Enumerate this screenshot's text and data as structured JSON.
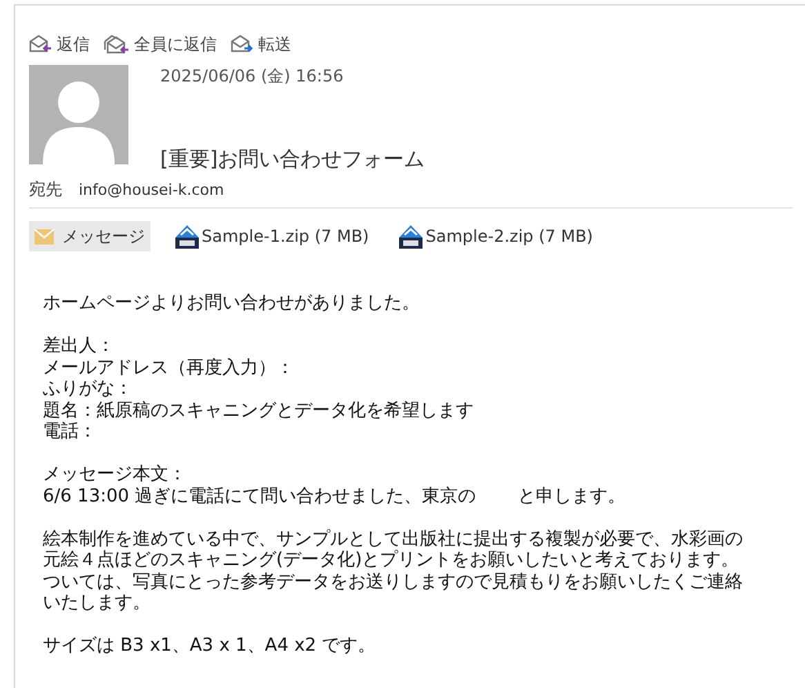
{
  "actions": [
    {
      "label": "返信",
      "kind": "reply"
    },
    {
      "label": "全員に返信",
      "kind": "reply-all"
    },
    {
      "label": "転送",
      "kind": "forward"
    }
  ],
  "date": "2025/06/06 (金) 16:56",
  "subject": "[重要]お問い合わせフォーム",
  "to": {
    "label": "宛先",
    "address": "info@housei-k.com"
  },
  "attachments": [
    {
      "label": "メッセージ",
      "kind": "message",
      "selected": true
    },
    {
      "label": "Sample-1.zip (7 MB)",
      "kind": "zip",
      "selected": false
    },
    {
      "label": "Sample-2.zip (7 MB)",
      "kind": "zip",
      "selected": false
    }
  ],
  "body": [
    [
      "ホームページよりお問い合わせがありました。"
    ],
    [
      "差出人：",
      "メールアドレス（再度入力）：",
      "ふりがな：",
      "題名：紙原稿のスキャニングとデータ化を希望します",
      "電話："
    ],
    [
      "メッセージ本文：",
      "6/6 13:00 過ぎに電話にて問い合わせました、東京の　　 と申します。"
    ],
    [
      "絵本制作を進めている中で、サンプルとして出版社に提出する複製が必要で、水彩画の",
      "元絵４点ほどのスキャニング(データ化)とプリントをお願いしたいと考えております。",
      "ついては、写真にとった参考データをお送りしますので見積もりをお願いしたくご連絡",
      "いたします。"
    ],
    [
      "サイズは B3 x1、A3 x 1、A4 x2 です。"
    ]
  ]
}
